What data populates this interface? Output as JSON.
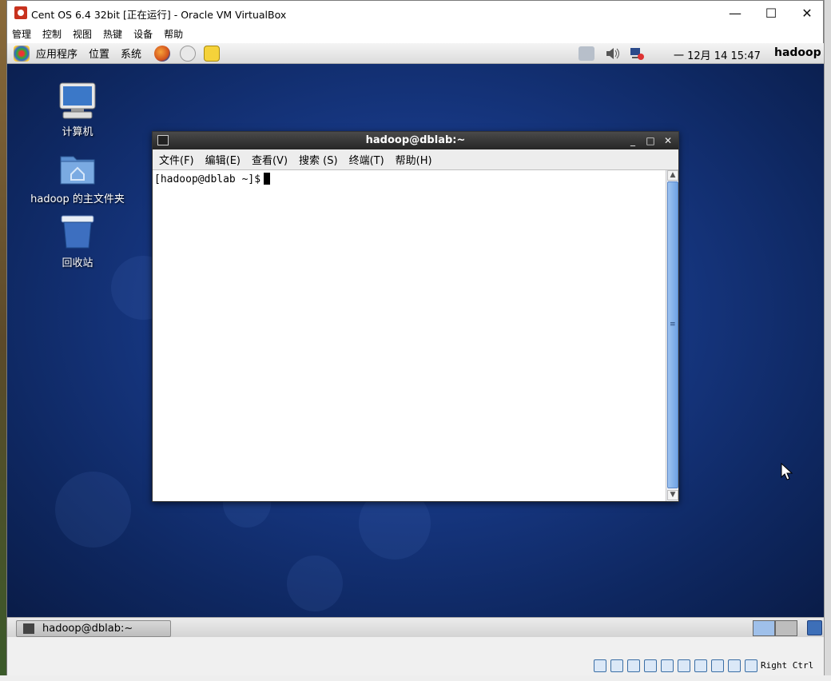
{
  "window": {
    "title": "Cent OS 6.4 32bit [正在运行] - Oracle VM VirtualBox",
    "minimize": "—",
    "maximize": "☐",
    "close": "✕"
  },
  "vbox_menu": [
    "管理",
    "控制",
    "视图",
    "热键",
    "设备",
    "帮助"
  ],
  "gnome_panel": {
    "applications": "应用程序",
    "places": "位置",
    "system": "系统",
    "clock": "一 12月 14 15:47",
    "user": "hadoop"
  },
  "desktop_icons": [
    {
      "label": "计算机",
      "icon": "computer-icon"
    },
    {
      "label": "hadoop 的主文件夹",
      "icon": "home-folder-icon"
    },
    {
      "label": "回收站",
      "icon": "trash-icon"
    }
  ],
  "terminal": {
    "title": "hadoop@dblab:~",
    "menu": [
      "文件(F)",
      "编辑(E)",
      "查看(V)",
      "搜索 (S)",
      "终端(T)",
      "帮助(H)"
    ],
    "prompt": "[hadoop@dblab ~]$"
  },
  "taskbar": {
    "task_label": "hadoop@dblab:~"
  },
  "vbox_status": {
    "host_key": "Right Ctrl"
  },
  "colors": {
    "desktop_blue": "#173884",
    "terminal_title": "#2e2e2e",
    "scroll_thumb": "#7aa8e6"
  }
}
